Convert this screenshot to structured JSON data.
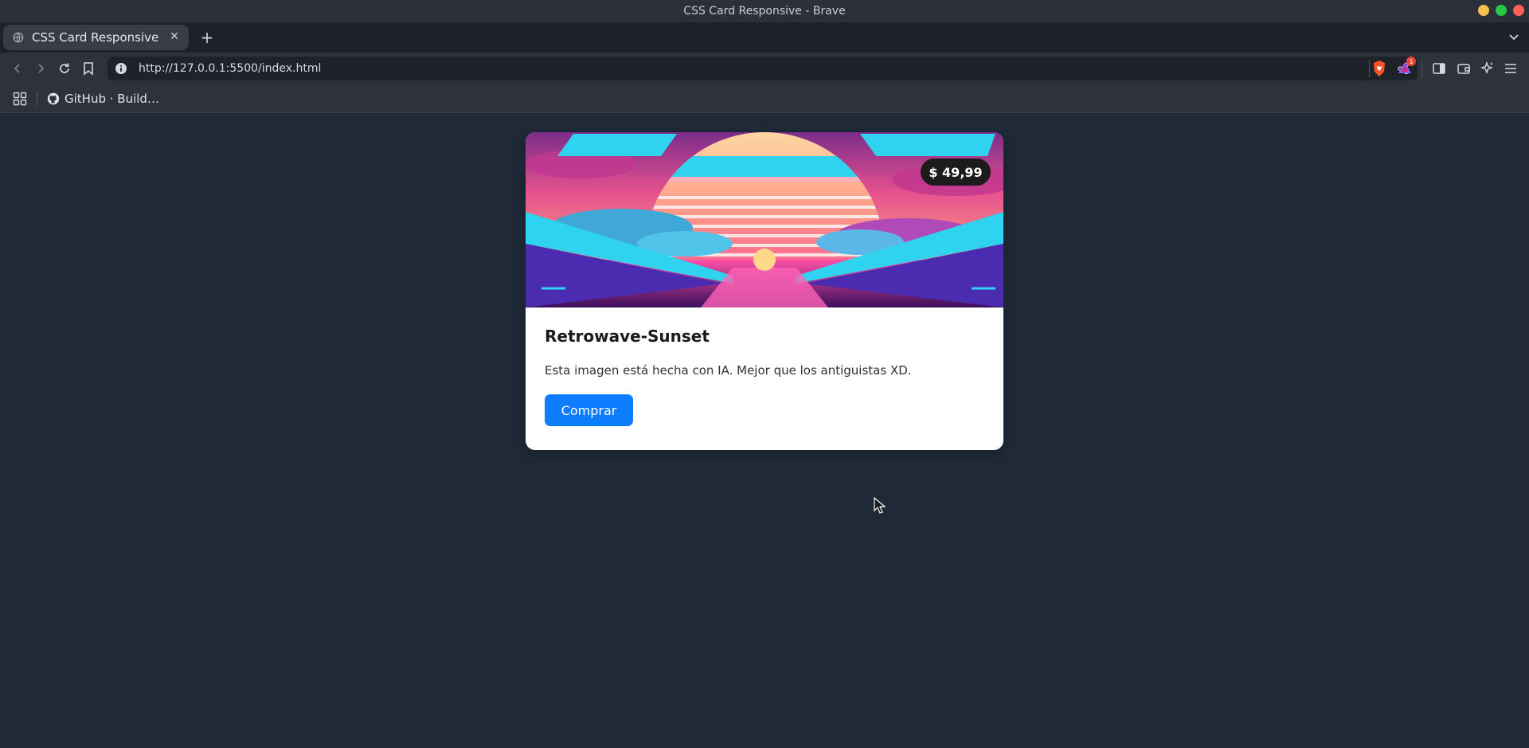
{
  "window": {
    "title": "CSS Card Responsive - Brave",
    "controls": {
      "minimize_color": "#f4bf4f",
      "maximize_color": "#28c840",
      "close_color": "#ff5f57"
    }
  },
  "tabs": [
    {
      "title": "CSS Card Responsive",
      "icon": "globe-icon",
      "active": true
    }
  ],
  "toolbar": {
    "url": "http://127.0.0.1:5500/index.html",
    "rewards_badge": "1"
  },
  "bookmarks": [
    {
      "label": "GitHub · Build…",
      "icon": "github-icon"
    }
  ],
  "card": {
    "image": "retrowave-sunset-illustration",
    "price": "$ 49,99",
    "title": "Retrowave-Sunset",
    "description": "Esta imagen está hecha con IA. Mejor que los antiguistas XD.",
    "button_label": "Comprar",
    "button_color": "#0d7cff"
  },
  "colors": {
    "page_background": "#1f2937",
    "card_background": "#ffffff"
  }
}
